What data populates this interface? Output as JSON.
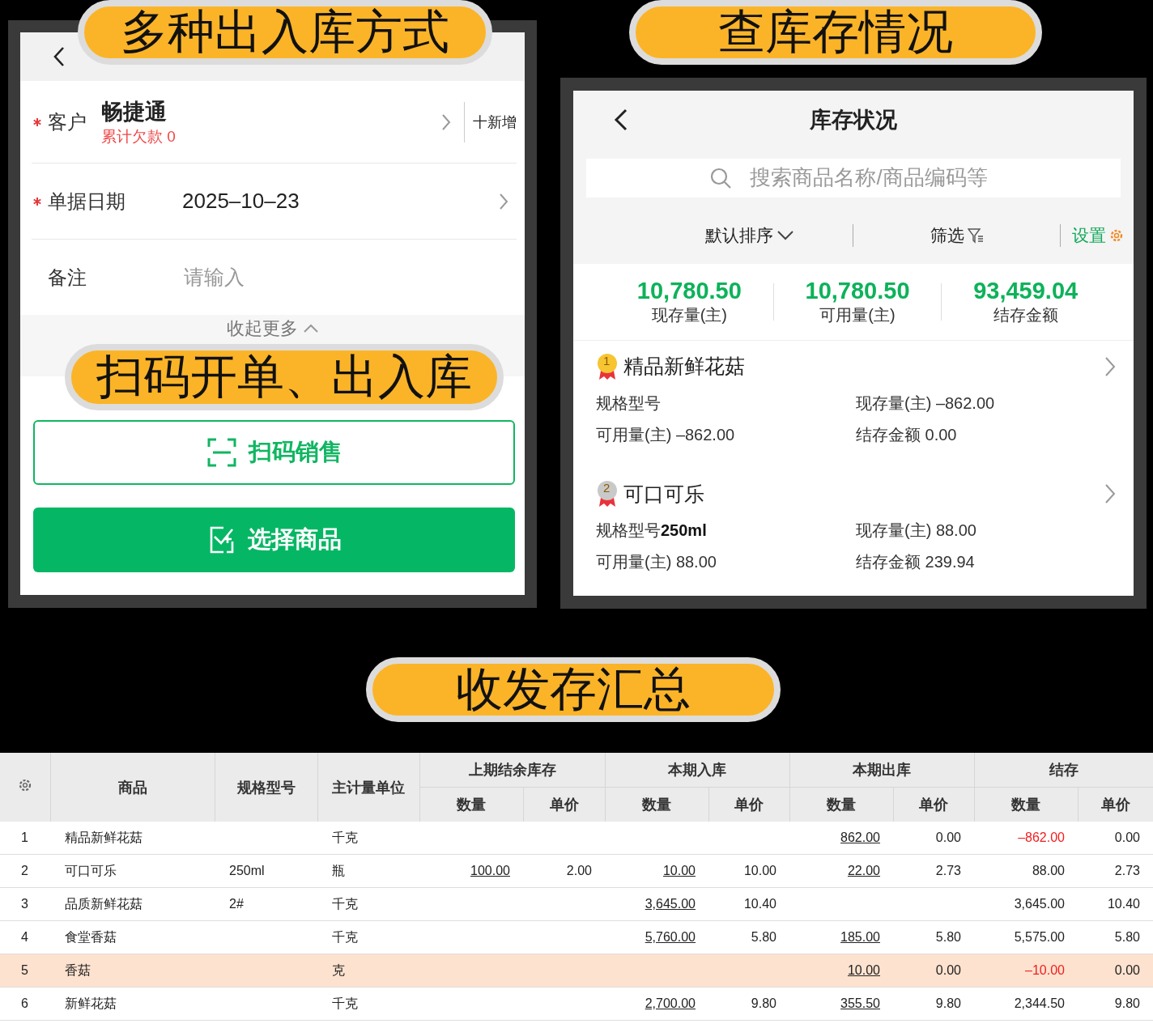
{
  "banners": [
    {
      "text": "多种出入库方式"
    },
    {
      "text": "扫码开单、出入库"
    },
    {
      "text": "查库存情况"
    },
    {
      "text": "收发存汇总"
    }
  ],
  "order_form": {
    "customer": {
      "label": "客户",
      "required": true,
      "name": "畅捷通",
      "debt": "累计欠款 0",
      "add_button": "十新增"
    },
    "date": {
      "label": "单据日期",
      "required": true,
      "value": "2025–10–23"
    },
    "note": {
      "label": "备注",
      "placeholder": "请输入"
    },
    "collapse": "收起更多",
    "scan_button": "扫码销售",
    "select_button": "选择商品"
  },
  "inventory": {
    "title": "库存状况",
    "search": {
      "placeholder": "搜索商品名称/商品编码等"
    },
    "sort": "默认排序",
    "filter": "筛选",
    "settings": "设置",
    "totals": [
      {
        "value": "10,780.50",
        "label": "现存量(主)"
      },
      {
        "value": "10,780.50",
        "label": "可用量(主)"
      },
      {
        "value": "93,459.04",
        "label": "结存金额"
      }
    ],
    "items": [
      {
        "rank": "1",
        "color": "#f7c531",
        "name": "精品新鲜花菇",
        "spec_label": "规格型号",
        "stock": "现存量(主) –862.00",
        "available": "可用量(主) –862.00",
        "amount": "结存金额 0.00"
      },
      {
        "rank": "2",
        "color": "#c9c9c9",
        "name": "可口可乐",
        "spec_label": "规格型号",
        "spec": "250ml",
        "stock": "现存量(主) 88.00",
        "available": "可用量(主) 88.00",
        "amount": "结存金额 239.94"
      }
    ]
  },
  "summary_table": {
    "columns": [
      "商品",
      "规格型号",
      "主计量单位"
    ],
    "groups": [
      "上期结余库存",
      "本期入库",
      "本期出库",
      "结存"
    ],
    "subcolumns": [
      "数量",
      "单价",
      "数量",
      "单价",
      "数量",
      "单价",
      "数量",
      "单价"
    ],
    "rows": [
      {
        "no": "1",
        "name": "精品新鲜花菇",
        "unit": "千克",
        "highlighted": false,
        "cells": [
          null,
          null,
          null,
          null,
          {
            "text": "862.00",
            "link": true
          },
          {
            "text": "0.00"
          },
          {
            "text": "–862.00",
            "negative": true
          },
          {
            "text": "0.00"
          }
        ]
      },
      {
        "no": "2",
        "name": "可口可乐",
        "spec": "250ml",
        "unit": "瓶",
        "highlighted": false,
        "cells": [
          {
            "text": "100.00",
            "link": true
          },
          {
            "text": "2.00"
          },
          {
            "text": "10.00",
            "link": true
          },
          {
            "text": "10.00"
          },
          {
            "text": "22.00",
            "link": true
          },
          {
            "text": "2.73"
          },
          {
            "text": "88.00"
          },
          {
            "text": "2.73"
          }
        ]
      },
      {
        "no": "3",
        "name": "品质新鲜花菇",
        "spec": "2#",
        "unit": "千克",
        "highlighted": false,
        "cells": [
          null,
          null,
          {
            "text": "3,645.00",
            "link": true
          },
          {
            "text": "10.40"
          },
          null,
          null,
          {
            "text": "3,645.00"
          },
          {
            "text": "10.40"
          }
        ]
      },
      {
        "no": "4",
        "name": "食堂香菇",
        "unit": "千克",
        "highlighted": false,
        "cells": [
          null,
          null,
          {
            "text": "5,760.00",
            "link": true
          },
          {
            "text": "5.80"
          },
          {
            "text": "185.00",
            "link": true
          },
          {
            "text": "5.80"
          },
          {
            "text": "5,575.00"
          },
          {
            "text": "5.80"
          }
        ]
      },
      {
        "no": "5",
        "name": "香菇",
        "unit": "克",
        "highlighted": true,
        "cells": [
          null,
          null,
          null,
          null,
          {
            "text": "10.00",
            "link": true
          },
          {
            "text": "0.00"
          },
          {
            "text": "–10.00",
            "negative": true
          },
          {
            "text": "0.00"
          }
        ]
      },
      {
        "no": "6",
        "name": "新鲜花菇",
        "unit": "千克",
        "highlighted": false,
        "cells": [
          null,
          null,
          {
            "text": "2,700.00",
            "link": true
          },
          {
            "text": "9.80"
          },
          {
            "text": "355.50",
            "link": true
          },
          {
            "text": "9.80"
          },
          {
            "text": "2,344.50"
          },
          {
            "text": "9.80"
          }
        ]
      }
    ]
  }
}
